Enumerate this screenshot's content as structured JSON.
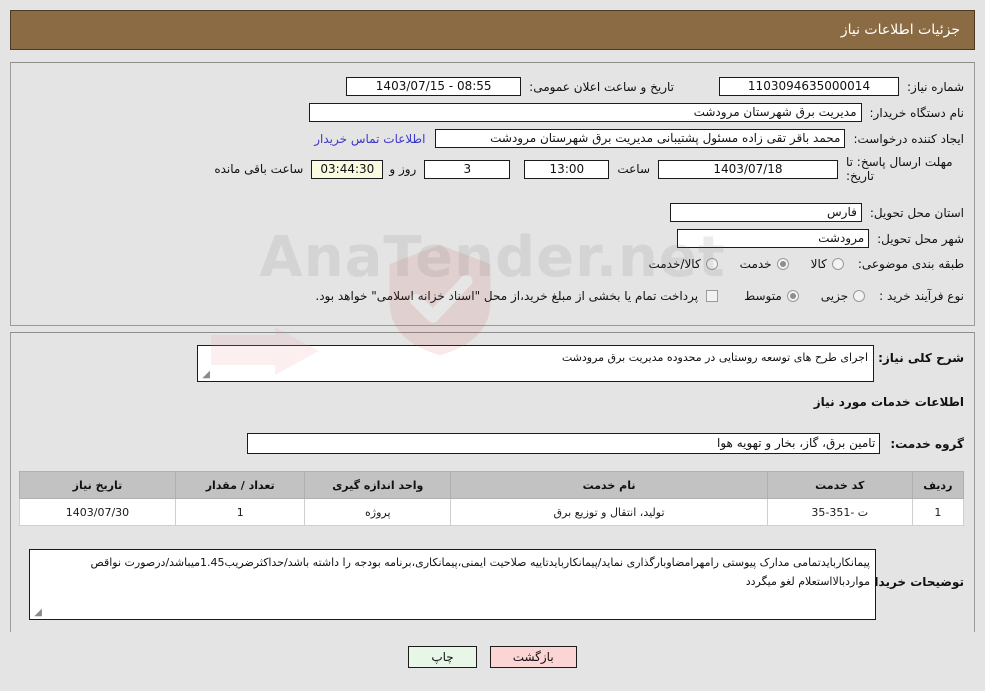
{
  "header": {
    "title": "جزئیات اطلاعات نیاز"
  },
  "fields": {
    "need_number_label": "شماره نیاز:",
    "need_number_value": "1103094635000014",
    "announce_label": "تاریخ و ساعت اعلان عمومی:",
    "announce_value": "08:55 - 1403/07/15",
    "buyer_org_label": "نام دستگاه خریدار:",
    "buyer_org_value": "مدیریت برق شهرستان مرودشت",
    "creator_label": "ایجاد کننده درخواست:",
    "creator_value": "محمد باقر  تقی زاده مسئول پشتیبانی مدیریت برق شهرستان مرودشت",
    "contact_link": "اطلاعات تماس خریدار",
    "deadline_label": "مهلت ارسال پاسخ: تا تاریخ:",
    "deadline_date": "1403/07/18",
    "hour_label": "ساعت",
    "hour_value": "13:00",
    "days_value": "3",
    "days_unit_label": "روز و",
    "timer_value": "03:44:30",
    "timer_suffix_label": "ساعت باقی مانده",
    "province_label": "استان محل تحویل:",
    "province_value": "فارس",
    "city_label": "شهر محل تحویل:",
    "city_value": "مرودشت",
    "category_label": "طبقه بندی موضوعی:",
    "process_label": "نوع فرآیند خرید :",
    "treasury_note": "پرداخت تمام یا بخشی از مبلغ خرید،از محل \"اسناد خزانه اسلامی\" خواهد بود."
  },
  "category_options": [
    {
      "label": "کالا",
      "selected": false
    },
    {
      "label": "خدمت",
      "selected": true
    },
    {
      "label": "کالا/خدمت",
      "selected": false
    }
  ],
  "process_options": [
    {
      "label": "جزیی",
      "selected": false
    },
    {
      "label": "متوسط",
      "selected": true
    }
  ],
  "description": {
    "label": "شرح کلی نیاز:",
    "value": "اجرای طرح های توسعه روستایی در محدوده مدیریت برق مرودشت"
  },
  "services_section": {
    "heading": "اطلاعات خدمات مورد نیاز",
    "group_label": "گروه خدمت:",
    "group_value": "تامین برق، گاز، بخار و تهویه هوا"
  },
  "table": {
    "columns": [
      "ردیف",
      "کد خدمت",
      "نام خدمت",
      "واحد اندازه گیری",
      "تعداد / مقدار",
      "تاریخ نیاز"
    ],
    "rows": [
      {
        "row_no": "1",
        "service_code": "ت -351-35",
        "service_name": "تولید، انتقال و توزیع برق",
        "unit": "پروژه",
        "quantity": "1",
        "need_date": "1403/07/30"
      }
    ]
  },
  "buyer_notes": {
    "label": "توضیحات خریدار:",
    "value": "پیمانکاربایدتمامی مدارک پیوستی رامهرامضاوبارگذاری نماید/پیمانکاربایدتاییه صلاحیت ایمنی،پیمانکاری،برنامه بودجه را داشته باشد/حداکثرضریب1.45میباشد/درصورت نواقص مواردبالااستعلام لغو میگردد"
  },
  "buttons": {
    "print": "چاپ",
    "back": "بازگشت"
  },
  "watermark": {
    "text": "AnaTender.net"
  },
  "colors": {
    "header_bg": "#8b6b44",
    "page_bg": "#e4e4e4",
    "link": "#3b37c8",
    "timer_bg": "#fbfbe2",
    "print_btn": "#e8f6e8",
    "back_btn": "#fbd4d4",
    "table_header_bg": "#c2c2c2"
  }
}
